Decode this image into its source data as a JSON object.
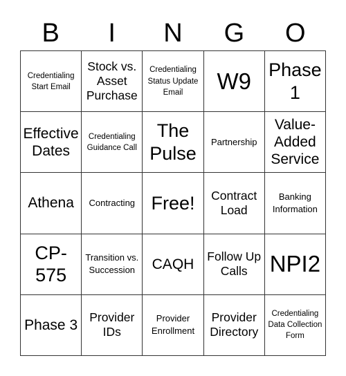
{
  "header": {
    "letters": [
      "B",
      "I",
      "N",
      "G",
      "O"
    ]
  },
  "board": {
    "cells": [
      {
        "text": "Credentialing Start Email",
        "size": "s-xs"
      },
      {
        "text": "Stock vs. Asset Purchase",
        "size": "s-md"
      },
      {
        "text": "Credentialing Status Update Email",
        "size": "s-xs"
      },
      {
        "text": "W9",
        "size": "s-xxl"
      },
      {
        "text": "Phase 1",
        "size": "s-xl"
      },
      {
        "text": "Effective Dates",
        "size": "s-lg"
      },
      {
        "text": "Credentialing Guidance Call",
        "size": "s-xs"
      },
      {
        "text": "The Pulse",
        "size": "s-xl"
      },
      {
        "text": "Partnership",
        "size": "s-sm"
      },
      {
        "text": "Value-Added Service",
        "size": "s-lg"
      },
      {
        "text": "Athena",
        "size": "s-lg"
      },
      {
        "text": "Contracting",
        "size": "s-sm"
      },
      {
        "text": "Free!",
        "size": "s-xl"
      },
      {
        "text": "Contract Load",
        "size": "s-md"
      },
      {
        "text": "Banking Information",
        "size": "s-sm"
      },
      {
        "text": "CP-575",
        "size": "s-xl"
      },
      {
        "text": "Transition vs. Succession",
        "size": "s-sm"
      },
      {
        "text": "CAQH",
        "size": "s-lg"
      },
      {
        "text": "Follow Up Calls",
        "size": "s-md"
      },
      {
        "text": "NPI2",
        "size": "s-xxl"
      },
      {
        "text": "Phase 3",
        "size": "s-lg"
      },
      {
        "text": "Provider IDs",
        "size": "s-md"
      },
      {
        "text": "Provider Enrollment",
        "size": "s-sm"
      },
      {
        "text": "Provider Directory",
        "size": "s-md"
      },
      {
        "text": "Credentialing Data Collection Form",
        "size": "s-xs"
      }
    ]
  }
}
